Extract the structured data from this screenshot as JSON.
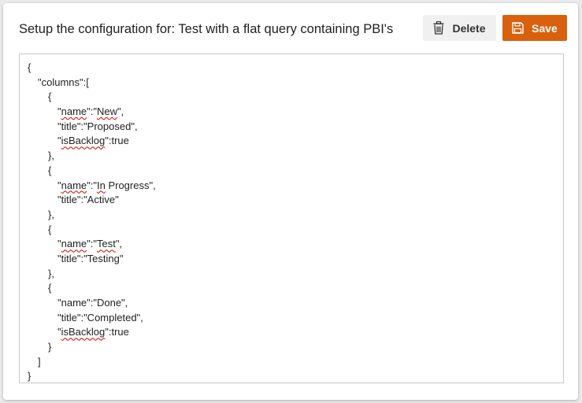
{
  "header": {
    "title": "Setup the configuration for: Test with a flat query containing PBI's",
    "delete_label": "Delete",
    "save_label": "Save"
  },
  "colors": {
    "save_button": "#d9600c",
    "delete_button": "#f0f0f0",
    "spellcheck_underline": "#d20000"
  },
  "icons": {
    "delete": "trash-icon",
    "save": "floppy-disk-icon"
  },
  "editor": {
    "lines": [
      {
        "indent": 0,
        "parts": [
          {
            "t": "{"
          }
        ]
      },
      {
        "indent": 1,
        "parts": [
          {
            "t": "\"columns\":["
          }
        ]
      },
      {
        "indent": 2,
        "parts": [
          {
            "t": "{"
          }
        ]
      },
      {
        "indent": 3,
        "parts": [
          {
            "t": "\""
          },
          {
            "t": "name",
            "sq": true
          },
          {
            "t": "\":\""
          },
          {
            "t": "New",
            "sq": true
          },
          {
            "t": "\","
          }
        ]
      },
      {
        "indent": 3,
        "parts": [
          {
            "t": "\"title\":\"Proposed\","
          }
        ]
      },
      {
        "indent": 3,
        "parts": [
          {
            "t": "\""
          },
          {
            "t": "isBacklog",
            "sq": true
          },
          {
            "t": "\":true"
          }
        ]
      },
      {
        "indent": 2,
        "parts": [
          {
            "t": "},"
          }
        ]
      },
      {
        "indent": 2,
        "parts": [
          {
            "t": "{"
          }
        ]
      },
      {
        "indent": 3,
        "parts": [
          {
            "t": "\""
          },
          {
            "t": "name",
            "sq": true
          },
          {
            "t": "\":\""
          },
          {
            "t": "In",
            "sq": true
          },
          {
            "t": " Progress\","
          }
        ]
      },
      {
        "indent": 3,
        "parts": [
          {
            "t": "\"title\":\"Active\""
          }
        ]
      },
      {
        "indent": 2,
        "parts": [
          {
            "t": "},"
          }
        ]
      },
      {
        "indent": 2,
        "parts": [
          {
            "t": "{"
          }
        ]
      },
      {
        "indent": 3,
        "parts": [
          {
            "t": "\""
          },
          {
            "t": "name",
            "sq": true
          },
          {
            "t": "\":\""
          },
          {
            "t": "Test",
            "sq": true
          },
          {
            "t": "\","
          }
        ]
      },
      {
        "indent": 3,
        "parts": [
          {
            "t": "\"title\":\"Testing\""
          }
        ]
      },
      {
        "indent": 2,
        "parts": [
          {
            "t": "},"
          }
        ]
      },
      {
        "indent": 2,
        "parts": [
          {
            "t": "{"
          }
        ]
      },
      {
        "indent": 3,
        "parts": [
          {
            "t": "\"name\":\"Done\","
          }
        ]
      },
      {
        "indent": 3,
        "parts": [
          {
            "t": "\"title\":\"Completed\","
          }
        ]
      },
      {
        "indent": 3,
        "parts": [
          {
            "t": "\""
          },
          {
            "t": "isBacklog",
            "sq": true
          },
          {
            "t": "\":true"
          }
        ]
      },
      {
        "indent": 2,
        "parts": [
          {
            "t": "}"
          }
        ]
      },
      {
        "indent": 1,
        "parts": [
          {
            "t": "]"
          }
        ]
      },
      {
        "indent": 0,
        "parts": [
          {
            "t": "}"
          }
        ]
      }
    ]
  }
}
